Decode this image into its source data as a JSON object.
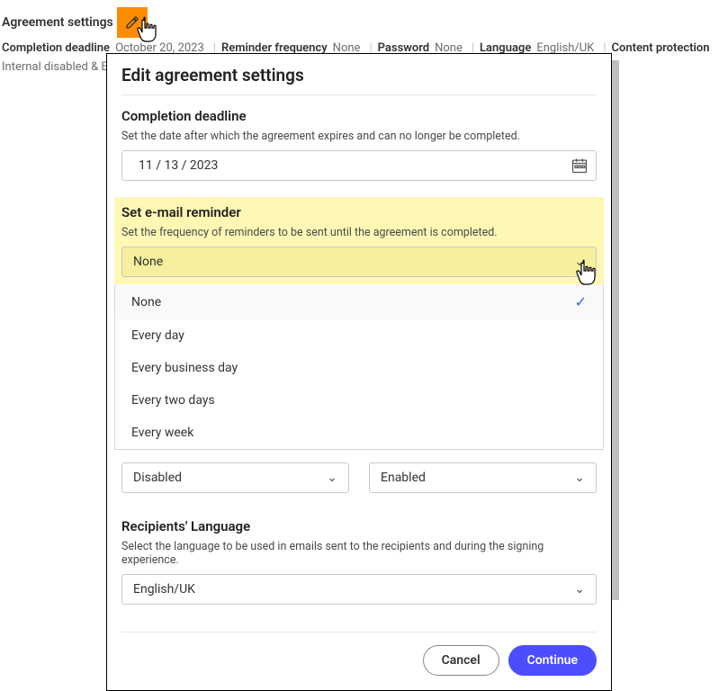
{
  "header": {
    "title": "Agreement settings",
    "summary": {
      "deadline_label": "Completion deadline",
      "deadline_value": "October 20, 2023",
      "reminder_label": "Reminder frequency",
      "reminder_value": "None",
      "password_label": "Password",
      "password_value": "None",
      "language_label": "Language",
      "language_value": "English/UK",
      "protection_label": "Content protection",
      "protection_value": "Internal disabled & External enabled"
    }
  },
  "modal": {
    "title": "Edit agreement settings",
    "deadline": {
      "title": "Completion deadline",
      "desc": "Set the date after which the agreement expires and can no longer be completed.",
      "value": "11 / 13 / 2023"
    },
    "reminder": {
      "title": "Set e-mail reminder",
      "desc": "Set the frequency of reminders to be sent until the agreement is completed.",
      "selected": "None",
      "options": [
        "None",
        "Every day",
        "Every business day",
        "Every two days",
        "Every week"
      ]
    },
    "protection": {
      "internal": "Disabled",
      "external": "Enabled"
    },
    "language": {
      "title": "Recipients' Language",
      "desc": "Select the language to be used in emails sent to the recipients and during the signing experience.",
      "selected": "English/UK"
    },
    "buttons": {
      "cancel": "Cancel",
      "continue": "Continue"
    }
  }
}
